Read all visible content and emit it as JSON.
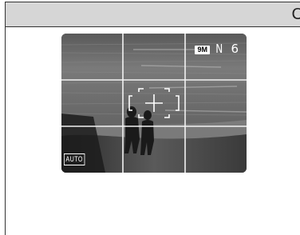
{
  "header": {
    "text": "C"
  },
  "viewfinder": {
    "image_size_badge": "9M",
    "quality": "N",
    "shots_remaining": "6",
    "shooting_mode": "AUTO"
  },
  "icons": {
    "focus_frame": "af-target-frame-icon",
    "grid": "framing-grid-icon"
  },
  "colors": {
    "header_bar": "#d6d6d6",
    "overlay_text": "#ffffff",
    "frame_line": "#333333"
  }
}
